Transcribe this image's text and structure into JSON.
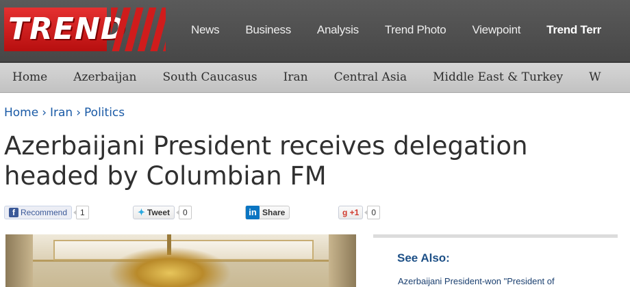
{
  "logo": {
    "text": "TREND"
  },
  "top_nav": [
    {
      "label": "News"
    },
    {
      "label": "Business"
    },
    {
      "label": "Analysis"
    },
    {
      "label": "Trend Photo"
    },
    {
      "label": "Viewpoint"
    },
    {
      "label": "Trend Terr"
    }
  ],
  "sub_nav": [
    {
      "label": "Home"
    },
    {
      "label": "Azerbaijan"
    },
    {
      "label": "South Caucasus"
    },
    {
      "label": "Iran"
    },
    {
      "label": "Central Asia"
    },
    {
      "label": "Middle East & Turkey"
    },
    {
      "label": "W"
    }
  ],
  "breadcrumb": {
    "items": [
      "Home",
      "Iran",
      "Politics"
    ],
    "separator": "›"
  },
  "article": {
    "title": "Azerbaijani President receives delegation headed by Columbian FM"
  },
  "share": {
    "facebook": {
      "icon": "f",
      "label": "Recommend",
      "count": "1"
    },
    "twitter": {
      "icon": "bird-icon",
      "label": "Tweet",
      "count": "0"
    },
    "linkedin": {
      "icon": "in",
      "label": "Share"
    },
    "googleplus": {
      "label": "g +1",
      "count": "0"
    }
  },
  "see_also": {
    "title": "See Also:",
    "links": [
      "Azerbaijani President-won \"President of"
    ]
  },
  "colors": {
    "brand_red": "#d01c1c",
    "top_bar": "#4f4f4f",
    "link_blue": "#1a5aa6"
  }
}
